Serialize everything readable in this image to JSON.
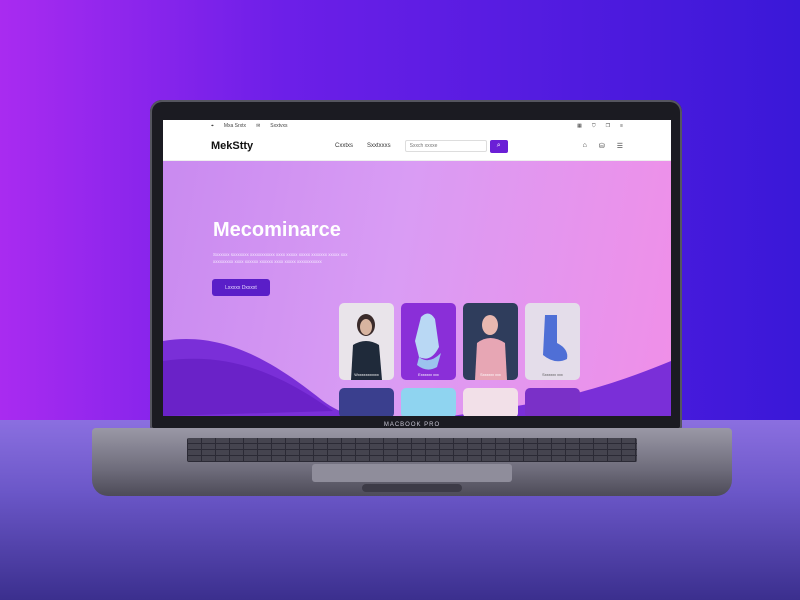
{
  "topbar": {
    "left_items": [
      "Mxa Srxtx",
      "Sxxtvxs"
    ],
    "right_icons": [
      "grid-icon",
      "filter-icon",
      "bookmark-icon",
      "menu-icon"
    ]
  },
  "navbar": {
    "logo": "MekStty",
    "links": [
      "Cxxtxs",
      "Sxxtxxxs"
    ],
    "search_placeholder": "Sxxch xxxxe",
    "icons": [
      "user-icon",
      "cart-icon",
      "menu-icon"
    ]
  },
  "hero": {
    "title": "Mecominarce",
    "subtitle": "Sxxxxxx sxxxxxxx xxxxxxxxxxx xxxx xxxxx xxxxx xxxxxxx xxxxx xxx xxxxxxxxx xxxx xxxxxx xxxxxx xxxx xxxxx xxxxxxxxxxx",
    "cta_label": "Lxxxxx Dxxxxt"
  },
  "products": [
    {
      "label": "Wxxxxxxxxxxx",
      "color": "#2b2530"
    },
    {
      "label": "Exxxxxx\nxxx",
      "color": "#a9c8ee"
    },
    {
      "label": "Sxxxxxx\nxxx",
      "color": "#e7a6b4"
    },
    {
      "label": "Sxxxxxx xxx",
      "color": "#4f6fd6"
    }
  ],
  "products_row2_colors": [
    "#3a3f8e",
    "#8fd4f0",
    "#f2e0e8",
    "#7a30c8"
  ],
  "brand": "MACBOOK PRO",
  "colors": {
    "accent": "#6b1fd6",
    "hero_start": "#c98af0",
    "hero_end": "#f08fe8"
  }
}
